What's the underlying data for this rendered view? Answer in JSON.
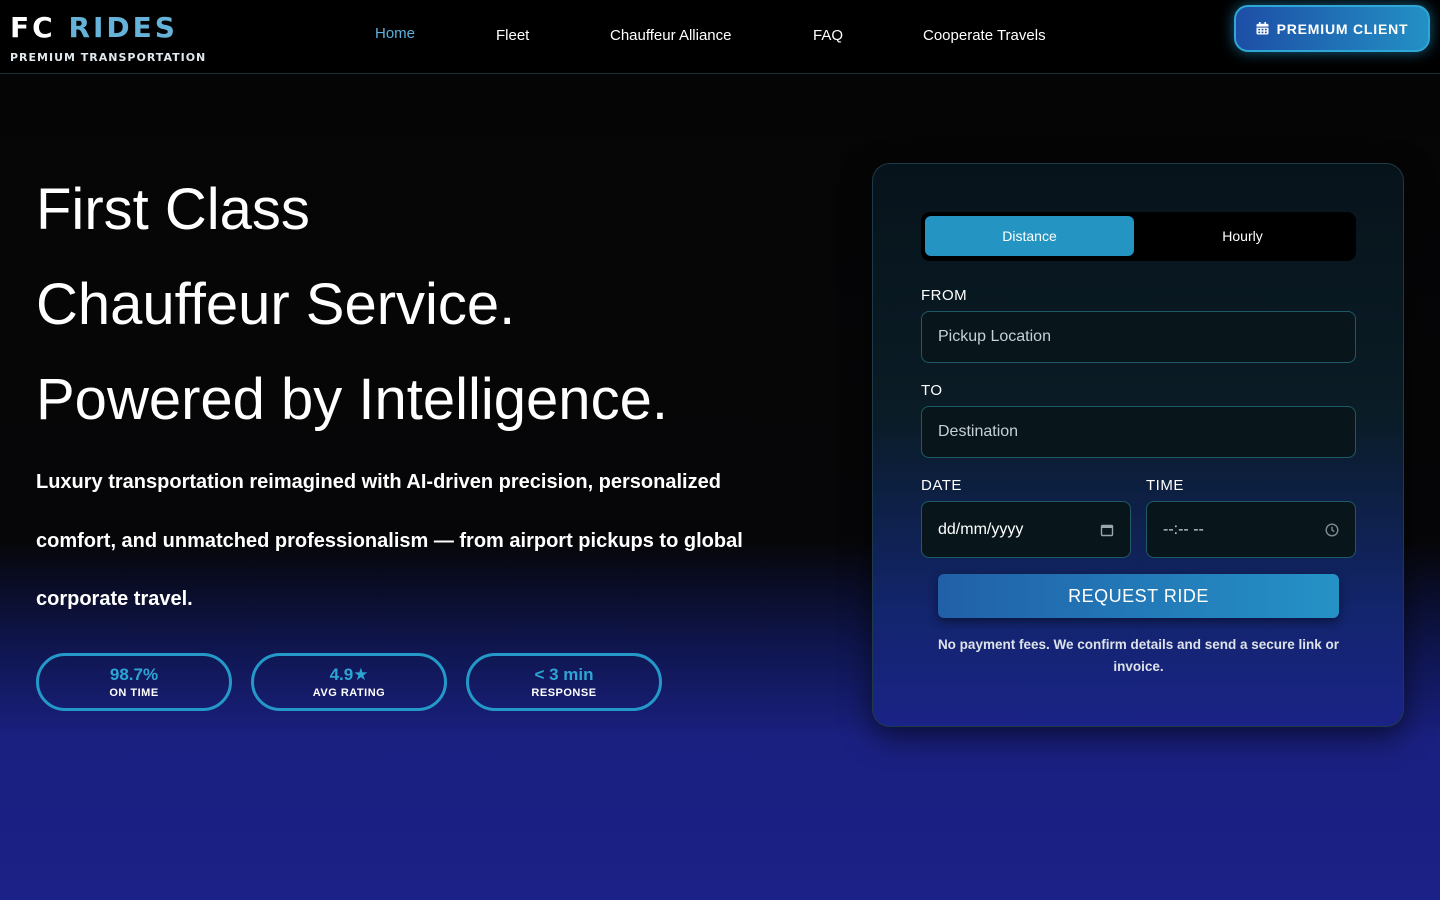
{
  "brand": {
    "title_main": "FC",
    "title_accent": "RIDES",
    "subtitle": "PREMIUM TRANSPORTATION"
  },
  "nav": {
    "links": [
      {
        "label": "Home",
        "active": true
      },
      {
        "label": "Fleet",
        "active": false
      },
      {
        "label": "Chauffeur Alliance",
        "active": false
      },
      {
        "label": "FAQ",
        "active": false
      },
      {
        "label": "Cooperate Travels",
        "active": false
      }
    ],
    "premium_label": "PREMIUM CLIENT",
    "premium_icon": "calendar-icon"
  },
  "hero": {
    "lines": [
      "First Class",
      "Chauffeur Service.",
      "Powered by Intelligence."
    ],
    "subtitle": "Luxury transportation reimagined with AI-driven precision, personalized comfort, and unmatched professionalism — from airport pickups to global corporate travel."
  },
  "stats": [
    {
      "value": "98.7%",
      "label": "ON TIME"
    },
    {
      "value": "4.9★",
      "label": "AVG RATING"
    },
    {
      "value": "< 3 min",
      "label": "RESPONSE"
    }
  ],
  "booking": {
    "tabs": [
      {
        "label": "Distance",
        "active": true
      },
      {
        "label": "Hourly",
        "active": false
      }
    ],
    "from_label": "FROM",
    "from_placeholder": "Pickup Location",
    "to_label": "TO",
    "to_placeholder": "Destination",
    "date_label": "DATE",
    "date_value": "dd/mm/yyyy",
    "time_label": "TIME",
    "time_value": "--:-- --",
    "submit_label": "REQUEST RIDE",
    "note": "No payment fees. We confirm details and send a secure link or invoice."
  },
  "colors": {
    "accent": "#2494c3",
    "brand_accent": "#66b3d9",
    "nav_active": "#5fb0dc",
    "background_bottom": "#1b2186"
  }
}
